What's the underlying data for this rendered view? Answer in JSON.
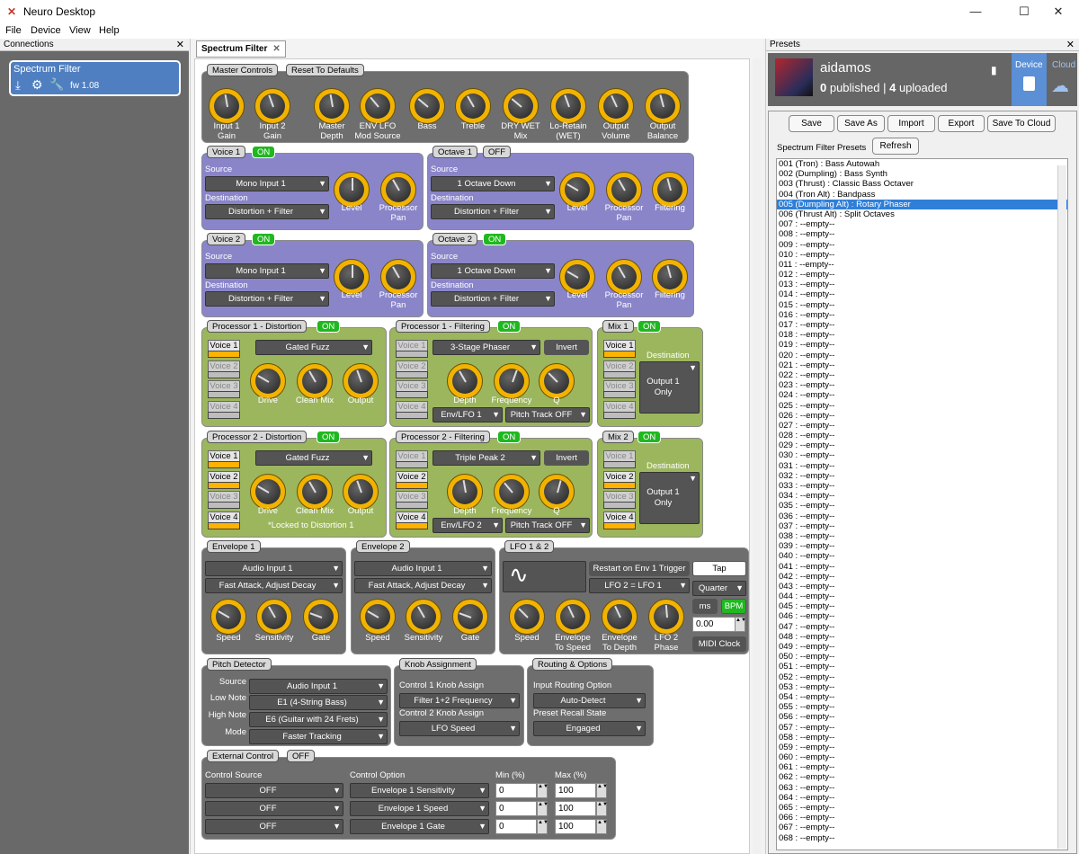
{
  "window": {
    "title": "Neuro Desktop",
    "min": "—",
    "max": "☐",
    "close": "✕"
  },
  "menu": [
    "File",
    "Device",
    "View",
    "Help"
  ],
  "connections": {
    "title": "Connections",
    "device_name": "Spectrum Filter",
    "fw": "fw 1.08"
  },
  "tab": {
    "label": "Spectrum Filter",
    "close": "✕"
  },
  "master": {
    "title": "Master Controls",
    "reset": "Reset To Defaults",
    "knobs": [
      {
        "label": "Input 1\nGain"
      },
      {
        "label": "Input 2\nGain"
      },
      {
        "label": "Master\nDepth"
      },
      {
        "label": "ENV    LFO\nMod Source"
      },
      {
        "label": "Bass"
      },
      {
        "label": "Treble"
      },
      {
        "label": "DRY    WET\nMix"
      },
      {
        "label": "Lo-Retain\n(WET)"
      },
      {
        "label": "Output\nVolume"
      },
      {
        "label": "Output\nBalance"
      }
    ]
  },
  "voice1": {
    "title": "Voice 1",
    "state": "ON",
    "source_label": "Source",
    "source": "Mono Input 1",
    "dest_label": "Destination",
    "dest": "Distortion + Filter",
    "k1": "Level",
    "k2": "Processor\nPan"
  },
  "octave1": {
    "title": "Octave 1",
    "state": "OFF",
    "source_label": "Source",
    "source": "1 Octave Down",
    "dest_label": "Destination",
    "dest": "Distortion + Filter",
    "k1": "Level",
    "k2": "Processor\nPan",
    "k3": "Filtering"
  },
  "voice2": {
    "title": "Voice 2",
    "state": "ON",
    "source_label": "Source",
    "source": "Mono Input 1",
    "dest_label": "Destination",
    "dest": "Distortion + Filter",
    "k1": "Level",
    "k2": "Processor\nPan"
  },
  "octave2": {
    "title": "Octave 2",
    "state": "ON",
    "source_label": "Source",
    "source": "1 Octave Down",
    "dest_label": "Destination",
    "dest": "Distortion + Filter",
    "k1": "Level",
    "k2": "Processor\nPan",
    "k3": "Filtering"
  },
  "voices": [
    "Voice 1",
    "Voice 2",
    "Voice 3",
    "Voice 4"
  ],
  "p1d": {
    "title": "Processor 1 - Distortion",
    "state": "ON",
    "type": "Gated Fuzz",
    "k1": "Drive",
    "k2": "Clean Mix",
    "k3": "Output"
  },
  "p1f": {
    "title": "Processor 1 - Filtering",
    "state": "ON",
    "type": "3-Stage Phaser",
    "invert": "Invert",
    "k1": "Depth",
    "k2": "Frequency",
    "k3": "Q",
    "mod": "Env/LFO 1",
    "track": "Pitch Track OFF"
  },
  "mix1": {
    "title": "Mix 1",
    "state": "ON",
    "dest_label": "Destination",
    "dest": "Output 1\nOnly"
  },
  "p2d": {
    "title": "Processor 2 - Distortion",
    "state": "ON",
    "type": "Gated Fuzz",
    "k1": "Drive",
    "k2": "Clean Mix",
    "k3": "Output",
    "note": "*Locked to Distortion 1"
  },
  "p2f": {
    "title": "Processor 2 - Filtering",
    "state": "ON",
    "type": "Triple Peak 2",
    "invert": "Invert",
    "k1": "Depth",
    "k2": "Frequency",
    "k3": "Q",
    "mod": "Env/LFO 2",
    "track": "Pitch Track OFF"
  },
  "mix2": {
    "title": "Mix 2",
    "state": "ON",
    "dest_label": "Destination",
    "dest": "Output 1\nOnly"
  },
  "env1": {
    "title": "Envelope 1",
    "source": "Audio Input 1",
    "mode": "Fast Attack, Adjust Decay",
    "k1": "Speed",
    "k2": "Sensitivity",
    "k3": "Gate"
  },
  "env2": {
    "title": "Envelope 2",
    "source": "Audio Input 1",
    "mode": "Fast Attack, Adjust Decay",
    "k1": "Speed",
    "k2": "Sensitivity",
    "k3": "Gate"
  },
  "lfo": {
    "title": "LFO 1 & 2",
    "restart": "Restart on Env 1 Trigger",
    "tap": "Tap",
    "lfo2": "LFO 2 = LFO 1",
    "div": "Quarter",
    "ms": "ms",
    "bpm": "BPM",
    "bpm_value": "0.00",
    "midi": "MIDI Clock",
    "k1": "Speed",
    "k2": "Envelope\nTo Speed",
    "k3": "Envelope\nTo Depth",
    "k4": "LFO 2\nPhase"
  },
  "pitch": {
    "title": "Pitch Detector",
    "source_label": "Source",
    "source": "Audio Input 1",
    "low_label": "Low Note",
    "low": "E1 (4-String Bass)",
    "high_label": "High Note",
    "high": "E6 (Guitar with 24 Frets)",
    "mode_label": "Mode",
    "mode": "Faster Tracking"
  },
  "knobassign": {
    "title": "Knob Assignment",
    "c1_label": "Control 1 Knob Assign",
    "c1": "Filter 1+2 Frequency",
    "c2_label": "Control 2 Knob Assign",
    "c2": "LFO Speed"
  },
  "routing": {
    "title": "Routing & Options",
    "in_label": "Input Routing Option",
    "in": "Auto-Detect",
    "recall_label": "Preset Recall State",
    "recall": "Engaged"
  },
  "ext": {
    "title": "External Control",
    "state": "OFF",
    "src_label": "Control Source",
    "opt_label": "Control Option",
    "min_label": "Min (%)",
    "max_label": "Max (%)",
    "rows": [
      {
        "src": "OFF",
        "opt": "Envelope 1 Sensitivity",
        "min": "0",
        "max": "100"
      },
      {
        "src": "OFF",
        "opt": "Envelope 1 Speed",
        "min": "0",
        "max": "100"
      },
      {
        "src": "OFF",
        "opt": "Envelope 1 Gate",
        "min": "0",
        "max": "100"
      }
    ]
  },
  "presets": {
    "title": "Presets",
    "user": "aidamos",
    "published_n": "0",
    "published": " published | ",
    "uploaded_n": "4",
    "uploaded": " uploaded",
    "device_tab": "Device",
    "cloud_tab": "Cloud",
    "buttons": [
      "Save",
      "Save As",
      "Import",
      "Export",
      "Save To Cloud"
    ],
    "list_label": "Spectrum Filter Presets",
    "refresh": "Refresh",
    "items": [
      "001 (Tron) : Bass Autowah",
      "002 (Dumpling) : Bass Synth",
      "003 (Thrust) : Classic Bass Octaver",
      "004 (Tron Alt) : Bandpass",
      "005 (Dumpling Alt) : Rotary Phaser",
      "006 (Thrust Alt) : Split Octaves",
      "007 : --empty--",
      "008 : --empty--",
      "009 : --empty--",
      "010 : --empty--",
      "011 : --empty--",
      "012 : --empty--",
      "013 : --empty--",
      "014 : --empty--",
      "015 : --empty--",
      "016 : --empty--",
      "017 : --empty--",
      "018 : --empty--",
      "019 : --empty--",
      "020 : --empty--",
      "021 : --empty--",
      "022 : --empty--",
      "023 : --empty--",
      "024 : --empty--",
      "025 : --empty--",
      "026 : --empty--",
      "027 : --empty--",
      "028 : --empty--",
      "029 : --empty--",
      "030 : --empty--",
      "031 : --empty--",
      "032 : --empty--",
      "033 : --empty--",
      "034 : --empty--",
      "035 : --empty--",
      "036 : --empty--",
      "037 : --empty--",
      "038 : --empty--",
      "039 : --empty--",
      "040 : --empty--",
      "041 : --empty--",
      "042 : --empty--",
      "043 : --empty--",
      "044 : --empty--",
      "045 : --empty--",
      "046 : --empty--",
      "047 : --empty--",
      "048 : --empty--",
      "049 : --empty--",
      "050 : --empty--",
      "051 : --empty--",
      "052 : --empty--",
      "053 : --empty--",
      "054 : --empty--",
      "055 : --empty--",
      "056 : --empty--",
      "057 : --empty--",
      "058 : --empty--",
      "059 : --empty--",
      "060 : --empty--",
      "061 : --empty--",
      "062 : --empty--",
      "063 : --empty--",
      "064 : --empty--",
      "065 : --empty--",
      "066 : --empty--",
      "067 : --empty--",
      "068 : --empty--"
    ],
    "selected_index": 4
  }
}
